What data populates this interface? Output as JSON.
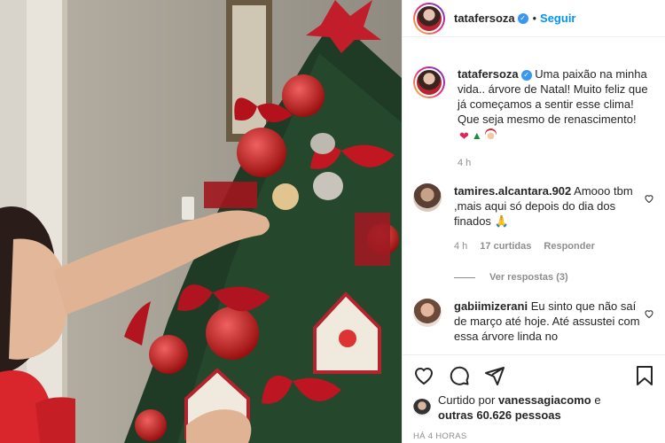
{
  "post": {
    "username": "tatafersoza",
    "follow_label": "Seguir",
    "dot": "•",
    "verified_glyph": "✓"
  },
  "caption": {
    "username": "tatafersoza",
    "text": "Uma paixão na minha vida.. árvore de Natal! Muito feliz que já começamos a sentir esse clima! Que seja mesmo de renascimento!",
    "emojis": [
      "heart-emoji",
      "christmas-tree-emoji",
      "santa-emoji"
    ],
    "time": "4 h"
  },
  "comments": [
    {
      "username": "tamires.alcantara.902",
      "text": "Amooo tbm ,mais aqui só depois do dia dos finados",
      "emoji": "folded-hands-emoji",
      "time": "4 h",
      "likes": "17 curtidas",
      "reply_label": "Responder",
      "view_replies": "Ver respostas (3)"
    },
    {
      "username": "gabiimizerani",
      "text": "Eu sinto que não saí de março até hoje. Até assustei com essa árvore linda no"
    }
  ],
  "likes": {
    "prefix": "Curtido por",
    "user": "vanessagiacomo",
    "connector": "e",
    "others": "outras 60.626 pessoas"
  },
  "timestamp": "HÁ 4 HORAS",
  "colors": {
    "link_blue": "#0095f6",
    "verified_blue": "#3897f0",
    "secondary_text": "#8e8e8e",
    "heart_red": "#e0245e"
  }
}
